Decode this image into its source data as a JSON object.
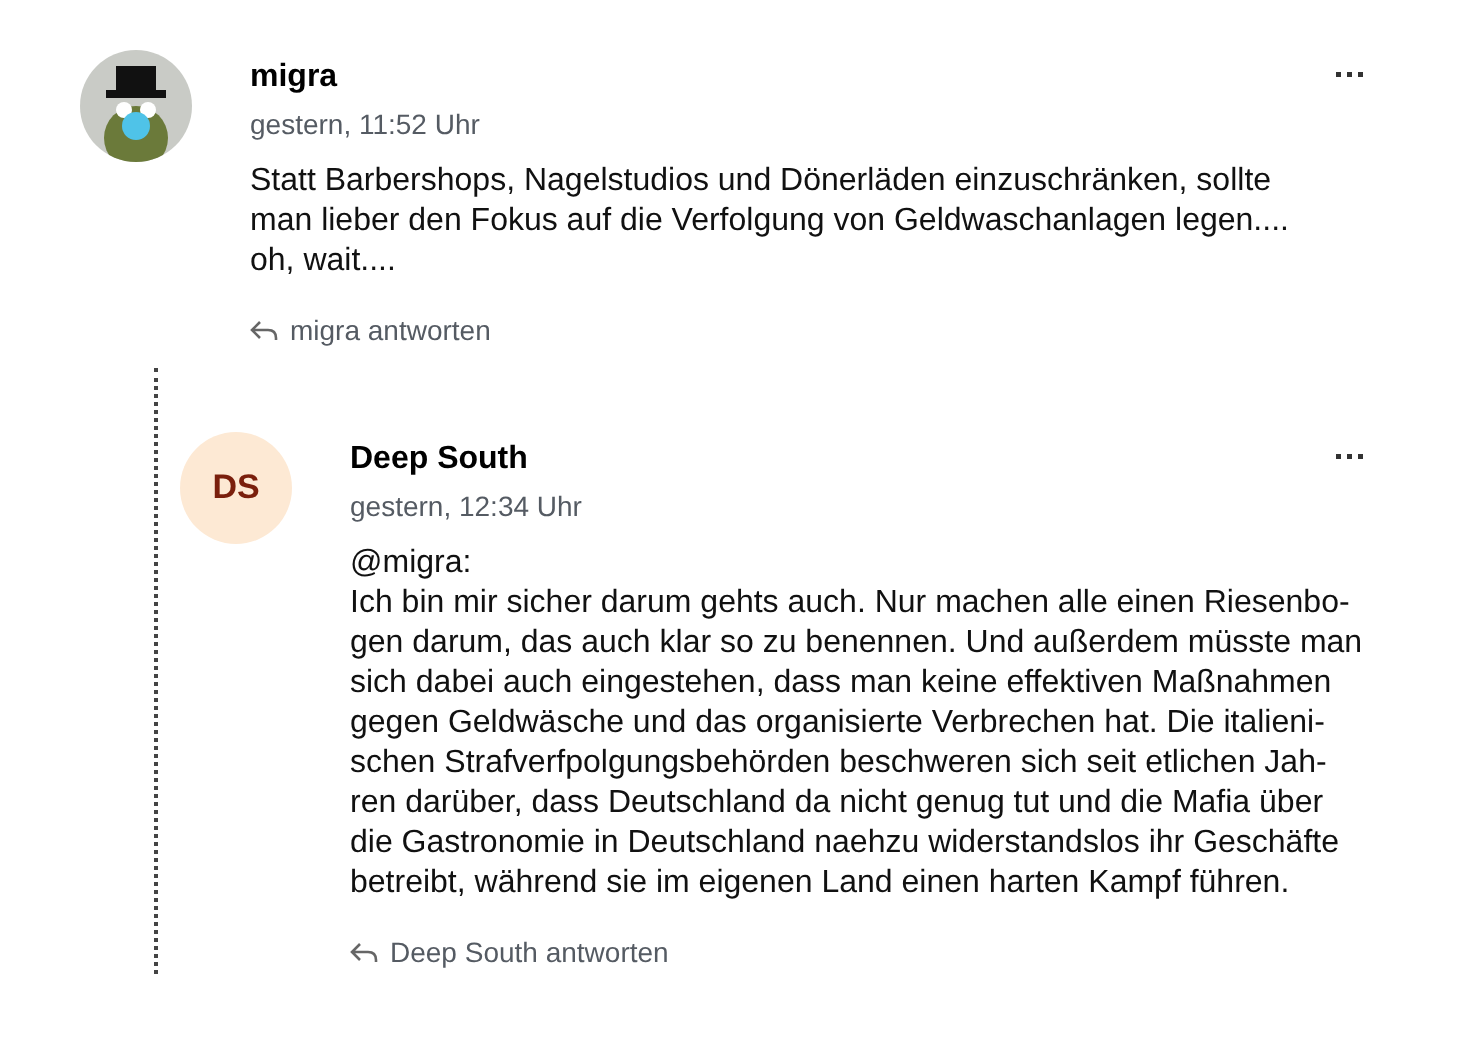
{
  "comments": [
    {
      "author": "migra",
      "kind": "photo",
      "time": "gestern, 11:52 Uhr",
      "text": "Statt Barbershops, Nagelstudios und Dönerläden einzuschränken, sollte\nman lieber den Fokus auf die Verfolgung von Geldwaschanlagen legen....\noh, wait....",
      "reply_label": "migra antworten",
      "children": [
        {
          "author": "Deep South",
          "kind": "initials",
          "initials": "DS",
          "time": "gestern, 12:34 Uhr",
          "text": "@migra:\nIch bin mir sicher darum gehts auch. Nur machen alle einen Riesenbo-\ngen darum, das auch klar so zu benennen. Und außerdem müsste man\nsich dabei auch eingestehen, dass man keine effektiven Maßnahmen\ngegen Geldwäsche und das organisierte Verbrechen hat. Die italieni-\nschen Strafverfpolgungsbehörden beschweren sich seit etlichen Jah-\nren darüber, dass Deutschland da nicht genug tut und die Mafia über\ndie Gastronomie in Deutschland naehzu widerstandslos ihr Geschäfte\nbetreibt, während sie im eigenen Land einen harten Kampf führen.",
          "reply_label": "Deep South antworten"
        }
      ]
    }
  ]
}
